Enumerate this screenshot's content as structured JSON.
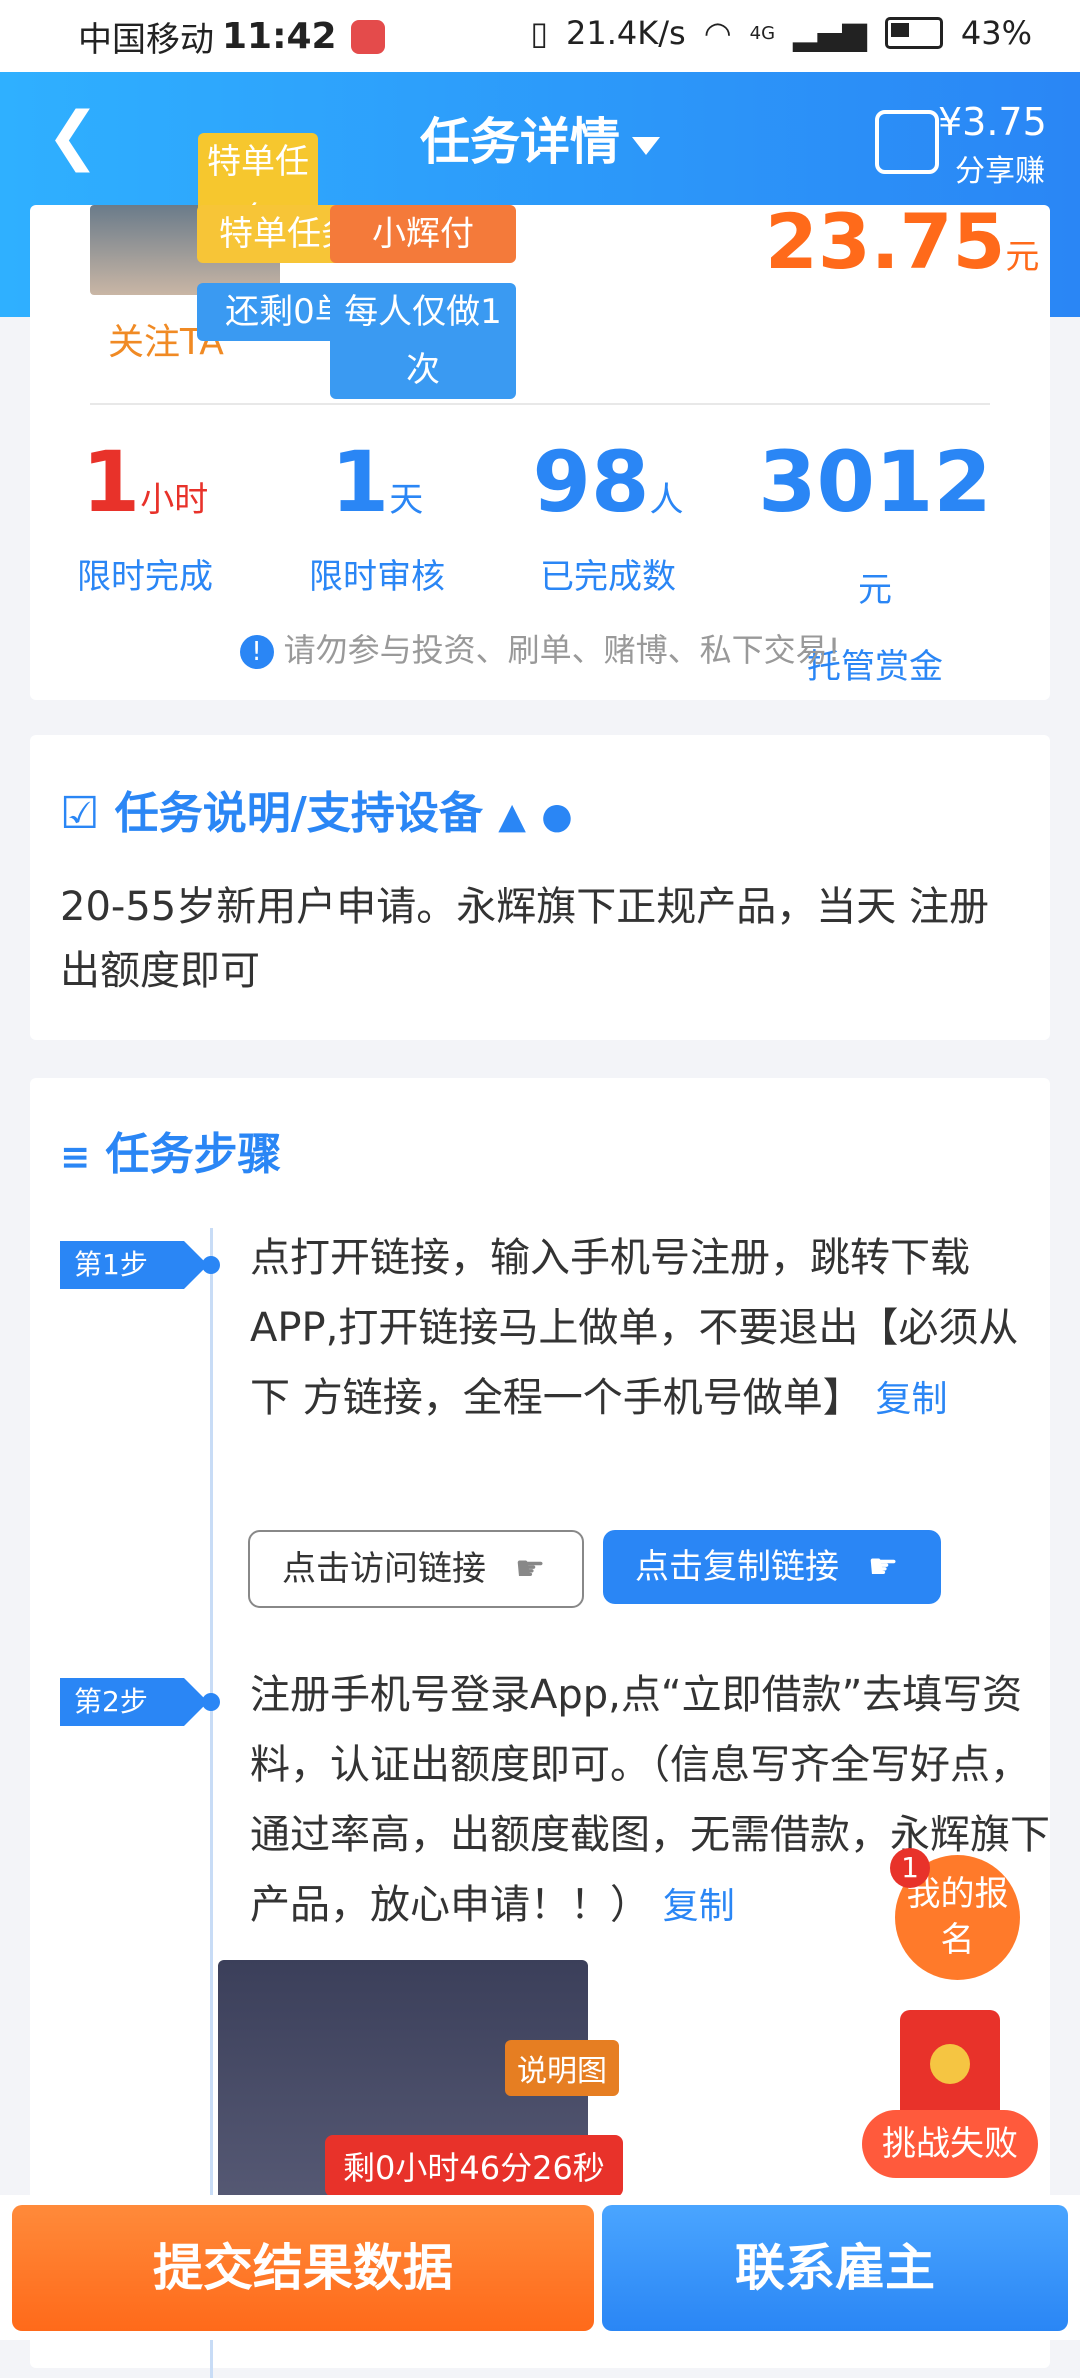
{
  "status_bar": {
    "carrier": "中国移动",
    "time": "11:42",
    "net_speed": "21.4K/s",
    "network": "4G",
    "battery": "43%"
  },
  "nav": {
    "title": "任务详情",
    "share_amount": "¥3.75",
    "share_label": "分享赚"
  },
  "task": {
    "follow_label": "关注TA",
    "tags": [
      "特单任务",
      "小辉付",
      "还剩0单",
      "每人仅做1次"
    ],
    "price": "23.75",
    "price_unit": "元",
    "stats": [
      {
        "value": "1",
        "unit": "小时",
        "label": "限时完成"
      },
      {
        "value": "1",
        "unit": "天",
        "label": "限时审核"
      },
      {
        "value": "98",
        "unit": "人",
        "label": "已完成数"
      },
      {
        "value": "3012",
        "unit": "元",
        "label": "托管赏金"
      }
    ],
    "warning": "请勿参与投资、刷单、赌博、私下交易!"
  },
  "description": {
    "title": "任务说明/支持设备",
    "text": "20-55岁新用户申请。永辉旗下正规产品，当天 注册出额度即可"
  },
  "steps": {
    "title": "任务步骤",
    "items": [
      {
        "tag": "第1步",
        "text": "点打开链接，输入手机号注册，跳转下载APP,打开链接马上做单，不要退出【必须从下 方链接，全程一个手机号做单】",
        "copy": "复制"
      },
      {
        "tag": "第2步",
        "text": "注册手机号登录App,点“立即借款”去填写资 料，认证出额度即可。（信息写齐全写好点， 通过率高，出额度截图，无需借款，永辉旗下 产品，放心申请！！）",
        "copy": "复制"
      }
    ],
    "visit_button": "点击访问链接",
    "copy_button": "点击复制链接",
    "image_label": "说明图"
  },
  "floating": {
    "badge_count": "1",
    "my_signup": "我的报名",
    "challenge_fail": "挑战失败",
    "timer": "剩0小时46分26秒"
  },
  "bottom": {
    "submit": "提交结果数据",
    "contact": "联系雇主"
  }
}
